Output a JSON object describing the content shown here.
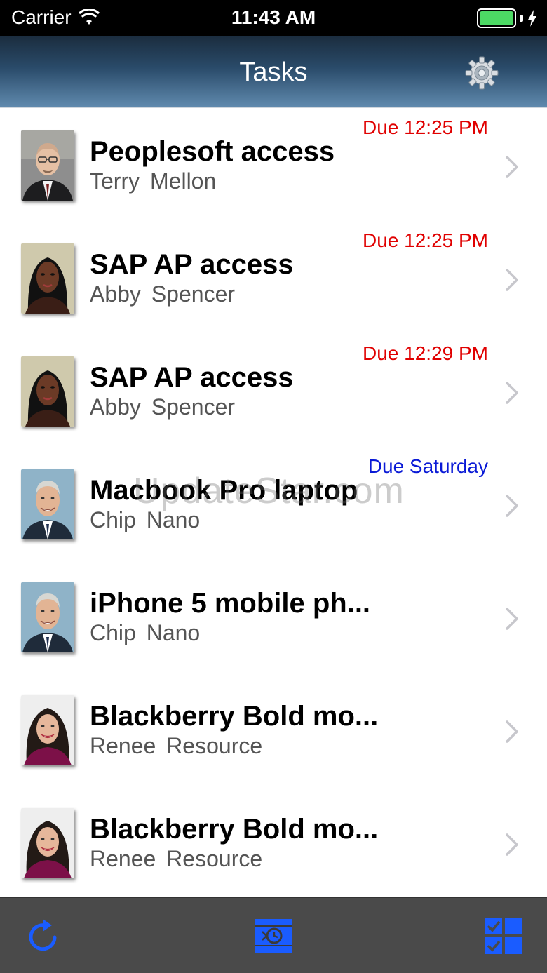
{
  "status_bar": {
    "carrier": "Carrier",
    "time": "11:43 AM",
    "battery_color": "#4cd964",
    "icons": [
      "wifi-icon",
      "battery-icon",
      "charging-icon"
    ]
  },
  "nav": {
    "title": "Tasks",
    "settings_icon": "gear-icon"
  },
  "tasks": [
    {
      "title": "Peoplesoft access",
      "first": "Terry",
      "last": "Mellon",
      "due": "Due 12:25 PM",
      "due_color": "red"
    },
    {
      "title": "SAP AP access",
      "first": "Abby",
      "last": "Spencer",
      "due": "Due 12:25 PM",
      "due_color": "red"
    },
    {
      "title": "SAP AP access",
      "first": "Abby",
      "last": "Spencer",
      "due": "Due 12:29 PM",
      "due_color": "red"
    },
    {
      "title": "Macbook Pro laptop",
      "first": "Chip",
      "last": "Nano",
      "due": "Due Saturday",
      "due_color": "blue"
    },
    {
      "title": "iPhone 5 mobile ph...",
      "first": "Chip",
      "last": "Nano",
      "due": "",
      "due_color": ""
    },
    {
      "title": "Blackberry Bold mo...",
      "first": "Renee",
      "last": "Resource",
      "due": "",
      "due_color": ""
    },
    {
      "title": "Blackberry Bold mo...",
      "first": "Renee",
      "last": "Resource",
      "due": "",
      "due_color": ""
    }
  ],
  "watermark": "UpdateStar.com",
  "tab_bar": {
    "items": [
      "refresh-icon",
      "timer-icon",
      "checklist-icon"
    ],
    "accent": "#1a5cff"
  }
}
